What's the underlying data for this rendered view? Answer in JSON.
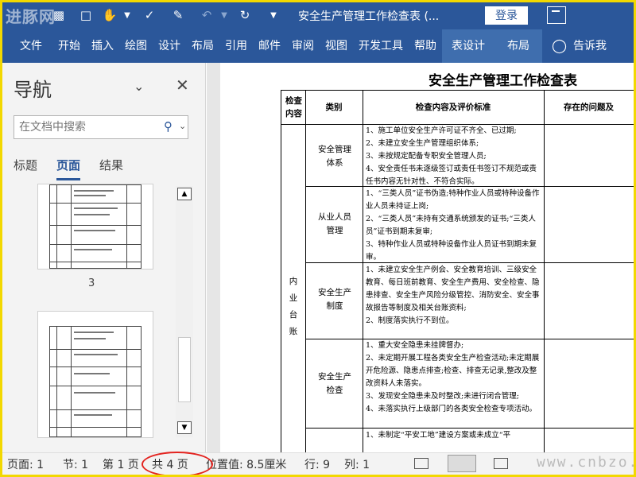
{
  "window": {
    "watermark_logo": "进豚网",
    "title": "安全生产管理工作检查表 (...",
    "login": "登录"
  },
  "ribbon": {
    "tabs": [
      "文件",
      "开始",
      "插入",
      "绘图",
      "设计",
      "布局",
      "引用",
      "邮件",
      "审阅",
      "视图",
      "开发工具",
      "帮助",
      "表设计",
      "布局"
    ],
    "tell_me": "告诉我"
  },
  "nav": {
    "title": "导航",
    "search_placeholder": "在文档中搜索",
    "tabs": [
      "标题",
      "页面",
      "结果"
    ],
    "active_tab": "页面",
    "page_label": "3"
  },
  "document": {
    "title": "安全生产管理工作检查表",
    "headers": [
      "检查内容",
      "类别",
      "检查内容及评价标准",
      "存在的问题及"
    ],
    "side_label": "内业台账",
    "rows": [
      {
        "category": "安全管理体系",
        "items": [
          "1、施工单位安全生产许可证不齐全、已过期;",
          "2、未建立安全生产管理组织体系;",
          "3、未按规定配备专职安全管理人员;",
          "4、安全责任书未逐级签订或责任书签订不规范或责任书内容无针对性、不符合实际。"
        ]
      },
      {
        "category": "从业人员管理",
        "items": [
          "1、“三类人员”证书伪造;特种作业人员或特种设备作业人员未持证上岗;",
          "2、“三类人员”未持有交通系统颁发的证书;“三类人员”证书到期未复审;",
          "3、特种作业人员或特种设备作业人员证书到期未复审。"
        ]
      },
      {
        "category": "安全生产制度",
        "items": [
          "1、未建立安全生产例会、安全教育培训、三级安全教育、每日班前教育、安全生产费用、安全检查、隐患排查、安全生产风险分级管控、消防安全、安全事故报告等制度及相关台账资料;",
          "2、制度落实执行不到位。"
        ]
      },
      {
        "category": "安全生产检查",
        "items": [
          "1、重大安全隐患未挂牌督办;",
          "2、未定期开展工程各类安全生产检查活动;未定期展开危险源、隐患点排查;检查、排查无记录,整改及整改资料人未落实。",
          "3、发现安全隐患未及时整改;未进行闭合管理;",
          "4、未落实执行上级部门的各类安全检查专项活动。"
        ]
      },
      {
        "category": "",
        "items": [
          "1、未制定“平安工地”建设方案或未成立“平"
        ]
      }
    ]
  },
  "status": {
    "page": "页面: 1",
    "section": "节: 1",
    "page_of": "第 1 页",
    "total": "共 4 页",
    "position": "位置值: 8.5厘米",
    "line": "行: 9",
    "column": "列: 1"
  },
  "site_watermark": "www.cnbzo.com",
  "colors": {
    "ribbon": "#2b579a",
    "highlight": "#e3231f",
    "frame": "#f2d800"
  }
}
